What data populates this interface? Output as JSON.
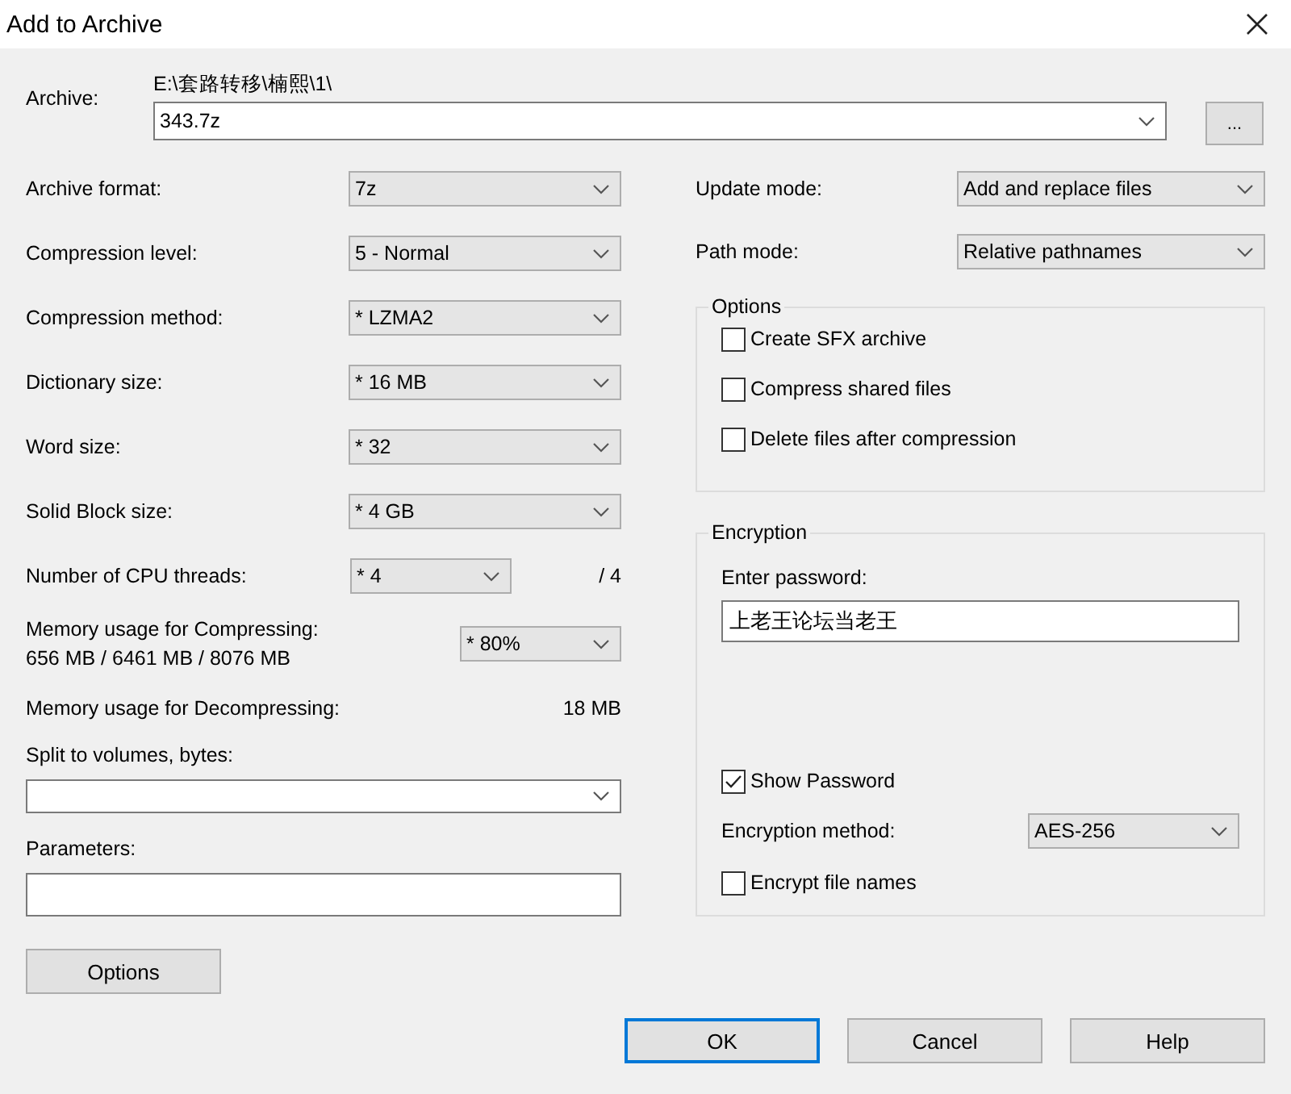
{
  "window": {
    "title": "Add to Archive"
  },
  "archive": {
    "label": "Archive:",
    "path": "E:\\套路转移\\楠熙\\1\\",
    "value": "343.7z",
    "browse": "..."
  },
  "compression": [
    {
      "label": "Archive format:",
      "value": "7z"
    },
    {
      "label": "Compression level:",
      "value": "5 - Normal"
    },
    {
      "label": "Compression method:",
      "value": "* LZMA2"
    },
    {
      "label": "Dictionary size:",
      "value": "* 16 MB"
    },
    {
      "label": "Word size:",
      "value": "* 32"
    },
    {
      "label": "Solid Block size:",
      "value": "* 4 GB"
    }
  ],
  "threads": {
    "label": "Number of CPU threads:",
    "value": "* 4",
    "max": "/ 4"
  },
  "memory_compress": {
    "label": "Memory usage for Compressing:",
    "detail": "656 MB / 6461 MB / 8076 MB",
    "value": "* 80%"
  },
  "memory_decompress": {
    "label": "Memory usage for Decompressing:",
    "value": "18 MB"
  },
  "split": {
    "label": "Split to volumes, bytes:"
  },
  "parameters": {
    "label": "Parameters:"
  },
  "options_button": "Options",
  "update_mode": {
    "label": "Update mode:",
    "value": "Add and replace files"
  },
  "path_mode": {
    "label": "Path mode:",
    "value": "Relative pathnames"
  },
  "options_group": {
    "title": "Options",
    "checkboxes": [
      {
        "label": "Create SFX archive",
        "checked": false
      },
      {
        "label": "Compress shared files",
        "checked": false
      },
      {
        "label": "Delete files after compression",
        "checked": false
      }
    ]
  },
  "encryption": {
    "title": "Encryption",
    "password_label": "Enter password:",
    "password": "上老王论坛当老王",
    "show_password": {
      "label": "Show Password",
      "checked": true
    },
    "method": {
      "label": "Encryption method:",
      "value": "AES-256"
    },
    "encrypt_names": {
      "label": "Encrypt file names",
      "checked": false
    }
  },
  "buttons": [
    {
      "label": "OK",
      "default": true
    },
    {
      "label": "Cancel",
      "default": false
    },
    {
      "label": "Help",
      "default": false
    }
  ]
}
